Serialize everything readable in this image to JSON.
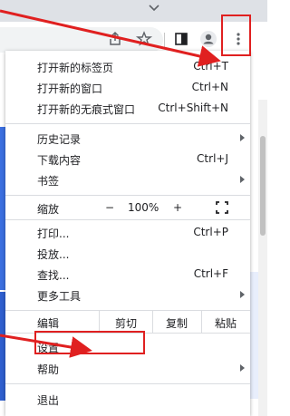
{
  "menu": {
    "new_tab": {
      "label": "打开新的标签页",
      "shortcut": "Ctrl+T"
    },
    "new_window": {
      "label": "打开新的窗口",
      "shortcut": "Ctrl+N"
    },
    "new_incognito": {
      "label": "打开新的无痕式窗口",
      "shortcut": "Ctrl+Shift+N"
    },
    "history": {
      "label": "历史记录"
    },
    "downloads": {
      "label": "下载内容",
      "shortcut": "Ctrl+J"
    },
    "bookmarks": {
      "label": "书签"
    },
    "zoom": {
      "label": "缩放",
      "minus": "−",
      "value": "100%",
      "plus": "+"
    },
    "print": {
      "label": "打印...",
      "shortcut": "Ctrl+P"
    },
    "cast": {
      "label": "投放..."
    },
    "find": {
      "label": "查找...",
      "shortcut": "Ctrl+F"
    },
    "more_tools": {
      "label": "更多工具"
    },
    "edit": {
      "label": "编辑",
      "cut": "剪切",
      "copy": "复制",
      "paste": "粘贴"
    },
    "settings": {
      "label": "设置"
    },
    "help": {
      "label": "帮助"
    },
    "exit": {
      "label": "退出"
    }
  },
  "toolbar": {
    "icons": [
      "share-icon",
      "bookmark-star-icon",
      "side-panel-icon",
      "profile-icon",
      "kebab-menu-icon"
    ]
  },
  "colors": {
    "annotation_red": "#e02020",
    "menu_bg": "#ffffff",
    "tabstrip_bg": "#dee1e6"
  }
}
